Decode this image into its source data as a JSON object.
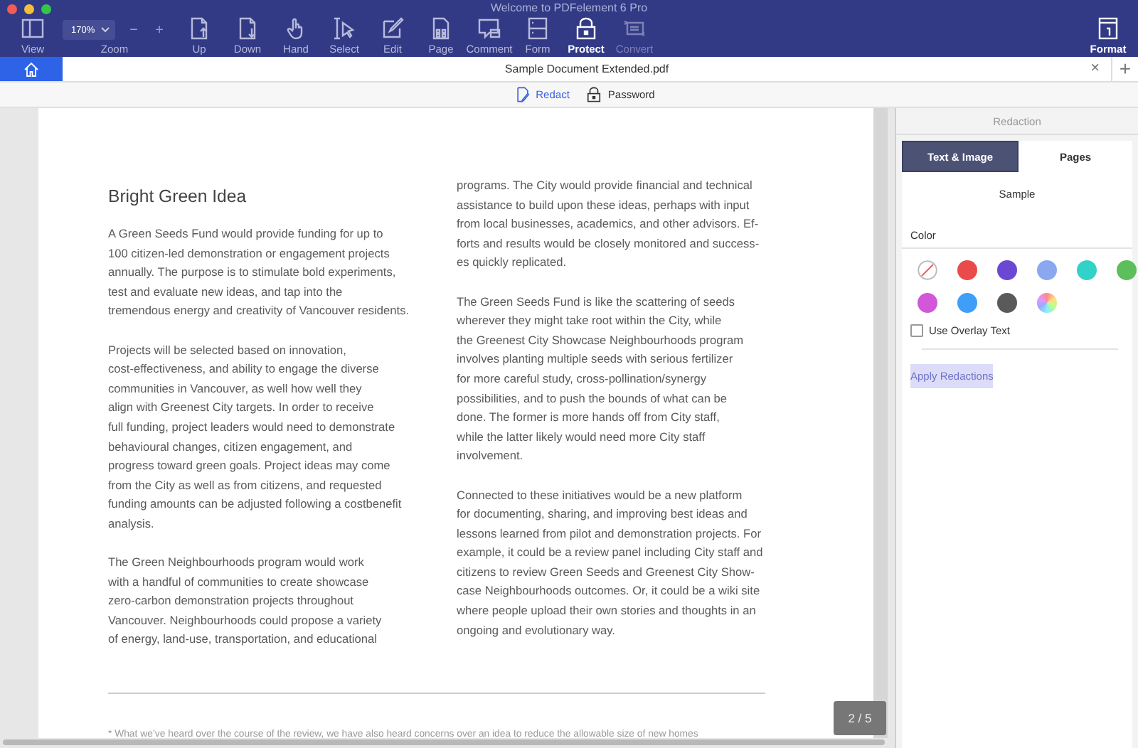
{
  "window": {
    "title": "Welcome to PDFelement 6 Pro"
  },
  "toolbar": {
    "view": {
      "label": "View",
      "selected": false,
      "disabled": false
    },
    "zoom": {
      "value": "170%",
      "label": "Zoom",
      "decrease": "−",
      "increase": "+"
    },
    "tools": [
      {
        "label": "Up",
        "selected": false,
        "disabled": false
      },
      {
        "label": "Down",
        "selected": false,
        "disabled": false
      },
      {
        "label": "Hand",
        "selected": false,
        "disabled": false
      },
      {
        "label": "Select",
        "selected": false,
        "disabled": false
      },
      {
        "label": "Edit",
        "selected": false,
        "disabled": false
      },
      {
        "label": "Page",
        "selected": false,
        "disabled": false
      },
      {
        "label": "Comment",
        "selected": false,
        "disabled": false
      },
      {
        "label": "Form",
        "selected": false,
        "disabled": false
      },
      {
        "label": "Protect",
        "selected": true,
        "disabled": false
      },
      {
        "label": "Convert",
        "selected": false,
        "disabled": true
      }
    ],
    "format": {
      "label": "Format",
      "selected": true,
      "disabled": false
    }
  },
  "tab_bar": {
    "documents": [
      {
        "title": "Sample Document Extended.pdf",
        "selected": true,
        "close": "×"
      }
    ],
    "new_tab": "+"
  },
  "protect_bar": [
    {
      "label": "Redact",
      "selected": true
    },
    {
      "label": "Password",
      "selected": false
    }
  ],
  "document": {
    "heading": "Bright Green Idea",
    "left_column": [
      "A Green Seeds Fund would provide funding for up to\n100 citizen-led demonstration or engagement projects\nannually. The purpose is to stimulate bold experiments,\ntest and evaluate new ideas, and tap into the\ntremendous energy and creativity of Vancouver residents.",
      "Projects will be selected based on innovation,\ncost-effectiveness, and ability to engage the diverse\ncommunities in Vancouver, as well how well they\nalign with Greenest City targets. In order to receive\nfull funding, project leaders would need to demonstrate\nbehavioural changes, citizen engagement, and\nprogress toward green goals. Project ideas may come\nfrom the City as well as from citizens, and requested\nfunding amounts can be adjusted following a costbenefit\nanalysis.",
      "The Green Neighbourhoods program would work\nwith a handful of communities to create showcase\nzero-carbon demonstration projects throughout\nVancouver. Neighbourhoods could propose a variety\nof energy, land-use, transportation, and educational"
    ],
    "right_column": [
      "programs. The City would provide financial and technical\nassistance to build upon these ideas, perhaps with input\nfrom local businesses, academics, and other advisors. Ef-\nforts and results would be closely monitored and success-\nes quickly replicated.",
      "The Green Seeds Fund is like the scattering of seeds\nwherever they might take root within the City, while\nthe Greenest City Showcase Neighbourhoods program\ninvolves planting multiple seeds with serious fertilizer\nfor more careful study, cross-pollination/synergy\npossibilities, and to push the bounds of what can be\ndone. The former is more hands off from City staff,\nwhile the latter likely would need more City staff\ninvolvement.",
      "Connected to these initiatives would be a new platform\nfor documenting, sharing, and improving best ideas and\nlessons learned from pilot and demonstration projects. For\nexample, it could be a review panel including City staff and\ncitizens to review Green Seeds and Greenest City Show-\ncase Neighbourhoods outcomes. Or, it could be a wiki site\nwhere people upload their own stories and thoughts in an\nongoing and evolutionary way."
    ],
    "footnote": "* What we’ve heard over the course of the review, we have also heard concerns over an idea to reduce the allowable size of new homes"
  },
  "page_indicator": "2 / 5",
  "panel": {
    "title": "Redaction",
    "tabs": [
      {
        "label": "Text & Image",
        "selected": true
      },
      {
        "label": "Pages",
        "selected": false
      }
    ],
    "preview": "Sample",
    "color_label": "Color",
    "swatches": [
      {
        "kind": "none",
        "selected": false
      },
      {
        "kind": "color",
        "color": "#e94b4b",
        "selected": false
      },
      {
        "kind": "color",
        "color": "#6a48d4",
        "selected": false
      },
      {
        "kind": "color",
        "color": "#8aa8f0",
        "selected": false
      },
      {
        "kind": "color",
        "color": "#33d2c8",
        "selected": false
      },
      {
        "kind": "color",
        "color": "#5cbf5c",
        "selected": false
      },
      {
        "kind": "color",
        "color": "#d257d8",
        "selected": false
      },
      {
        "kind": "color",
        "color": "#3f9ef8",
        "selected": false
      },
      {
        "kind": "color",
        "color": "#5a5a5a",
        "selected": false
      },
      {
        "kind": "spectrum",
        "selected": false
      }
    ],
    "overlay": {
      "label": "Use Overlay Text",
      "checked": false
    },
    "apply": {
      "label": "Apply Redactions",
      "disabled": true
    }
  }
}
